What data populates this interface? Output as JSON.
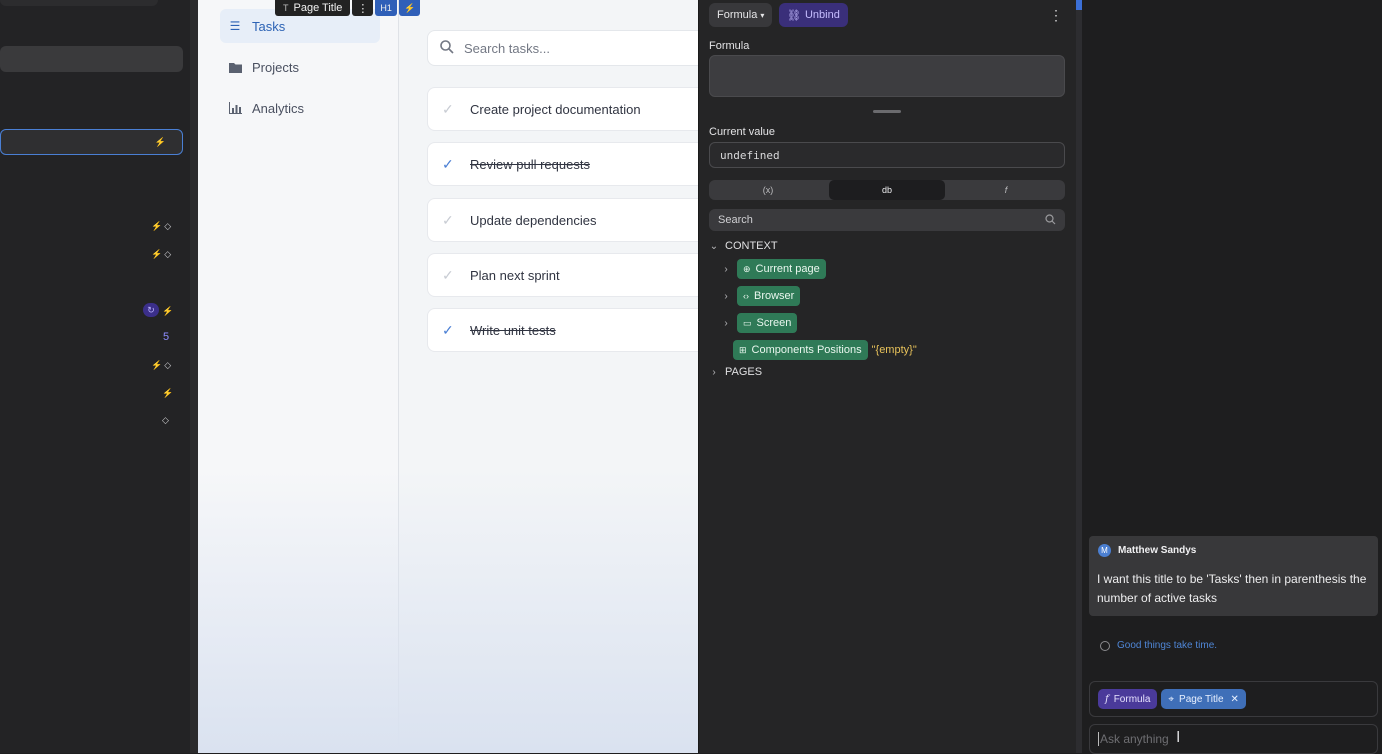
{
  "left_panel": {
    "number_value": "5"
  },
  "element_toolbar": {
    "name": "Page Title",
    "heading_tag": "H1",
    "more_glyph": "⋮"
  },
  "app": {
    "nav": [
      {
        "label": "Tasks",
        "icon": "list-icon",
        "active": true
      },
      {
        "label": "Projects",
        "icon": "folder-icon",
        "active": false
      },
      {
        "label": "Analytics",
        "icon": "bar-chart-icon",
        "active": false
      }
    ],
    "search_placeholder": "Search tasks...",
    "tasks": [
      {
        "label": "Create project documentation",
        "completed": false
      },
      {
        "label": "Review pull requests",
        "completed": true
      },
      {
        "label": "Update dependencies",
        "completed": false
      },
      {
        "label": "Plan next sprint",
        "completed": false
      },
      {
        "label": "Write unit tests",
        "completed": true
      }
    ]
  },
  "formula_panel": {
    "mode_button": "Formula",
    "unbind_button": "Unbind",
    "formula_label": "Formula",
    "formula_value": "",
    "current_value_label": "Current value",
    "current_value": "undefined",
    "segments": [
      "(x)",
      "db",
      "f"
    ],
    "search_placeholder": "Search",
    "context_heading": "CONTEXT",
    "context_items": [
      {
        "label": "Current page",
        "icon": "globe-icon",
        "expandable": true
      },
      {
        "label": "Browser",
        "icon": "code-icon",
        "expandable": true
      },
      {
        "label": "Screen",
        "icon": "monitor-icon",
        "expandable": true
      },
      {
        "label": "Components Positions",
        "icon": "grid-icon",
        "expandable": false,
        "value": "\"{empty}\""
      }
    ],
    "pages_heading": "PAGES"
  },
  "chat": {
    "author_initial": "M",
    "author_name": "Matthew Sandys",
    "message": "I want this title to be 'Tasks' then in parenthesis the number of active tasks",
    "status_text": "Good things take time.",
    "context_chips": [
      {
        "label": "Formula",
        "icon": "function-icon"
      },
      {
        "label": "Page Title",
        "icon": "cursor-icon"
      }
    ],
    "input_placeholder": "Ask anything"
  },
  "colors": {
    "accent_blue": "#2d63b5",
    "tree_green": "#2f7a57",
    "unbind_purple": "#3a2f7a",
    "empty_value_yellow": "#e8c25a"
  }
}
